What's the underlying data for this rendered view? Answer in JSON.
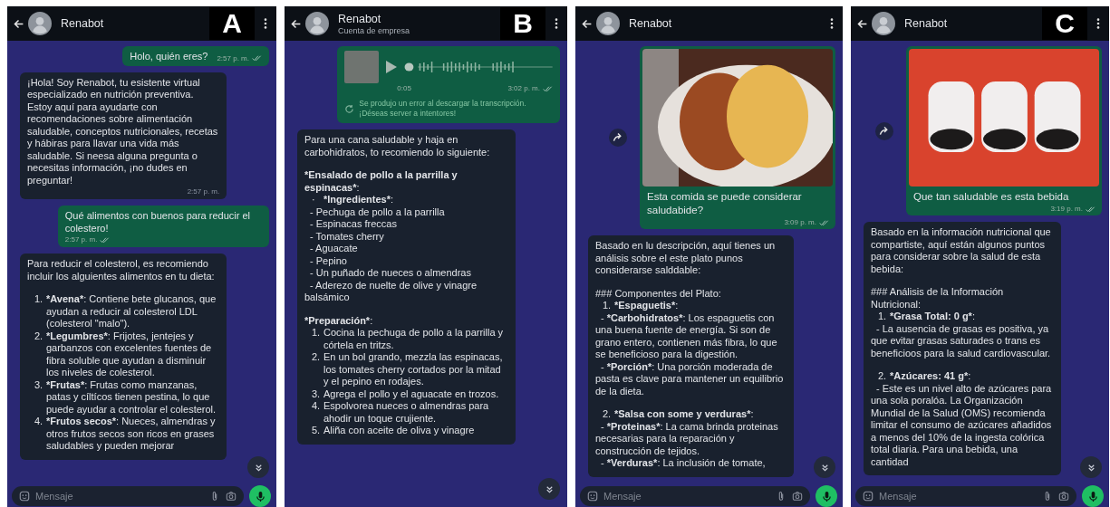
{
  "panels": [
    {
      "label": "A",
      "header": {
        "name": "Renabot"
      },
      "input": {
        "placeholder": "Mensaje"
      },
      "messages": [
        {
          "kind": "text",
          "outgoing": true,
          "text": "Holo, quién eres?",
          "time": "2:57 p. m."
        },
        {
          "kind": "text",
          "outgoing": false,
          "text": "¡Hola! Soy Renabot, tu esistente virtual especializado en nutrición preventiva. Estoy aquí para ayudarte con recomendaciones sobre alimentación saludable, conceptos nutricionales, recetas y hábiras para llavar una vida más saludable. Si neesa alguna pregunta o necesitas información, ¡no dudes en preguntar!",
          "time": "2:57 p. m."
        },
        {
          "kind": "text",
          "outgoing": true,
          "text": "Qué alimentos con buenos para reducir el colestero!",
          "time": "2:57 p. m."
        },
        {
          "kind": "formatted",
          "outgoing": false,
          "sections": [
            {
              "blocks": [
                {
                  "kind": "para",
                  "text": "Para reducir el colesterol, es recomiendo incluir los alguientes alimentos en tu dieta:"
                }
              ]
            },
            {
              "blocks": [
                {
                  "kind": "item",
                  "number": "1.",
                  "term": "*Avena*",
                  "text": ": Contiene bete glucanos, que ayudan a reducir al colesterol LDL (colesterol \"malo\")."
                },
                {
                  "kind": "item",
                  "number": "2.",
                  "term": "*Legumbres*",
                  "text": ": Frijotes, jentejes y garbanzos con excelentes fuentes de fibra soluble que ayudan a disminuir los niveles de colesterol."
                },
                {
                  "kind": "item",
                  "number": "3.",
                  "term": "*Frutas*",
                  "text": ": Frutas como manzanas, patas y cíltícos tienen pestina, lo que puede ayudar a controlar el colesterol."
                },
                {
                  "kind": "item",
                  "number": "4.",
                  "term": "*Frutos secos*",
                  "text": ": Nueces, almendras y otros frutos secos son ricos en grases saludables y pueden mejorar"
                }
              ]
            }
          ]
        }
      ]
    },
    {
      "label": "B",
      "header": {
        "name": "Renabot",
        "subtitle": "Cuenta de empresa"
      },
      "messages": [
        {
          "kind": "voice",
          "outgoing": true,
          "duration": "0:05",
          "time": "3:02 p. m.",
          "error": [
            "Se produjo un error al descargar la transcripción.",
            "¡Déseas server a intentores!"
          ]
        },
        {
          "kind": "formatted",
          "outgoing": false,
          "sections": [
            {
              "blocks": [
                {
                  "kind": "para",
                  "text": "Para una cana saludable y haja en carbohidratos, to recomiendo lo siguiente:"
                }
              ]
            },
            {
              "blocks": [
                {
                  "kind": "para",
                  "term": "*Ensalado de pollo a la parrilla y espinacas*",
                  "text": ":"
                },
                {
                  "kind": "item",
                  "number": "·",
                  "term": "*Ingredientes*",
                  "text": ":"
                },
                {
                  "kind": "sub",
                  "text": "- Pechuga de pollo a la parrilla"
                },
                {
                  "kind": "sub",
                  "text": "- Espinacas freccas"
                },
                {
                  "kind": "sub",
                  "text": "- Tomates cherry"
                },
                {
                  "kind": "sub",
                  "text": "- Aguacate"
                },
                {
                  "kind": "sub",
                  "text": "- Pepino"
                },
                {
                  "kind": "sub",
                  "text": "- Un puñado de nueces o almendras"
                },
                {
                  "kind": "sub",
                  "text": "- Aderezo de nuelte de olive y vinagre balsámico"
                }
              ]
            },
            {
              "blocks": [
                {
                  "kind": "para",
                  "term": "*Preparación*",
                  "text": ":"
                },
                {
                  "kind": "item",
                  "number": "1.",
                  "text": "Cocina la pechuga de pollo a la parrilla y córtela en tritzs."
                },
                {
                  "kind": "item",
                  "number": "2.",
                  "text": "En un bol grando, mezzla las espinacas, los tomates cherry cortados por la mitad y el pepino en rodajes."
                },
                {
                  "kind": "item",
                  "number": "3.",
                  "text": "Agrega el pollo y el aguacate en trozos."
                },
                {
                  "kind": "item",
                  "number": "4.",
                  "text": "Espolvorea nueces o almendras para ahodir un toque crujiente."
                },
                {
                  "kind": "item",
                  "number": "5.",
                  "text": "Aliña con aceite de oliva y vinagre"
                }
              ]
            }
          ]
        }
      ]
    },
    {
      "header": {
        "name": "Renabot"
      },
      "input": {
        "placeholder": "Mensaje"
      },
      "messages": [
        {
          "kind": "image",
          "outgoing": true,
          "photo": {
            "kind": "plate"
          },
          "caption": "Esta comida se puede considerar saludabide?",
          "time": "3:09 p. m."
        },
        {
          "kind": "formatted",
          "outgoing": false,
          "sections": [
            {
              "blocks": [
                {
                  "kind": "para",
                  "text": "Basado en lu descripción, aquí tienes un análisis sobre el este plato punos considerarse salddable:"
                }
              ]
            },
            {
              "blocks": [
                {
                  "kind": "para",
                  "text": "### Componentes del Plato:"
                },
                {
                  "kind": "item",
                  "number": "1.",
                  "term": "*Espaguetis*",
                  "text": ":"
                },
                {
                  "kind": "sub",
                  "lead": "- ",
                  "term": "*Carbohidratos*",
                  "text": ": Los espaguetis con una buena fuente de energía. Si son de grano entero, contienen más fibra, lo que se beneficioso para la digestión."
                },
                {
                  "kind": "sub",
                  "lead": "- ",
                  "term": "*Porción*",
                  "text": ": Una porción moderada de pasta es clave para mantener un equilibrio de la dieta."
                }
              ]
            },
            {
              "blocks": [
                {
                  "kind": "item",
                  "number": "2.",
                  "term": "*Salsa con some y verduras*",
                  "text": ":"
                },
                {
                  "kind": "sub",
                  "lead": "- ",
                  "term": "*Proteinas*",
                  "text": ": La cama brinda proteinas necesarias para la reparación y construcción de tejidos."
                },
                {
                  "kind": "sub",
                  "lead": "- ",
                  "term": "*Verduras*",
                  "text": ": La inclusión de tomate,"
                }
              ]
            }
          ]
        }
      ]
    },
    {
      "label": "C",
      "header": {
        "name": "Renabot"
      },
      "input": {
        "placeholder": "Mensaje"
      },
      "messages": [
        {
          "kind": "image",
          "outgoing": true,
          "photo": {
            "kind": "label"
          },
          "caption": "Que tan saludable es esta bebida",
          "time": "3:19 p. m."
        },
        {
          "kind": "formatted",
          "outgoing": false,
          "sections": [
            {
              "blocks": [
                {
                  "kind": "para",
                  "text": "Basado en la información nutricional que compartiste, aquí están algunos puntos para considerar sobre la salud de esta bebida:"
                }
              ]
            },
            {
              "blocks": [
                {
                  "kind": "para",
                  "text": "### Análisis de la Información Nutricional:"
                },
                {
                  "kind": "item",
                  "number": "1.",
                  "term": "*Grasa Total: 0 g*",
                  "text": ":"
                },
                {
                  "kind": "sub",
                  "lead": "- ",
                  "text": "La ausencia de grasas es positiva, ya que evitar grasas saturades o trans es beneficioos para la salud cardiovascular."
                }
              ]
            },
            {
              "blocks": [
                {
                  "kind": "item",
                  "number": "2.",
                  "term": "*Azúcares: 41 g*",
                  "text": ":"
                },
                {
                  "kind": "sub",
                  "lead": "- ",
                  "text": "Este es un nivel alto de azúcares para una sola poralóa. La Organización Mundial de la Salud (OMS) recomienda limitar el consumo de azúcares añadidos a menos del 10% de la ingesta colórica total diaria. Para una bebida, una cantidad"
                }
              ]
            }
          ]
        }
      ]
    }
  ]
}
